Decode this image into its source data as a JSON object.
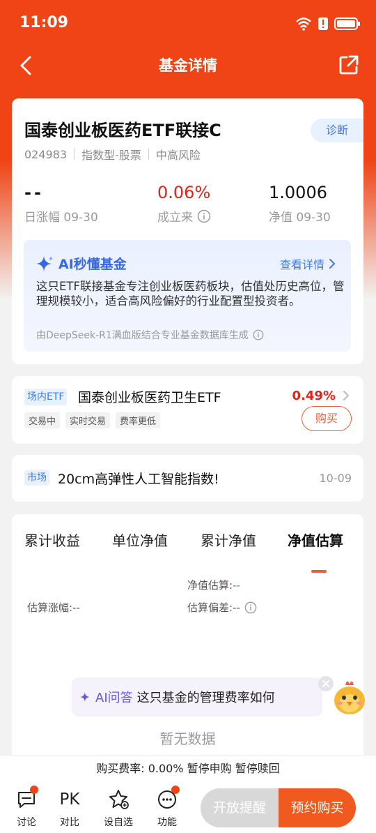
{
  "status": {
    "time": "11:09"
  },
  "nav": {
    "title": "基金详情"
  },
  "fund": {
    "name": "国泰创业板医药ETF联接C",
    "diagnose_label": "诊断",
    "code": "024983",
    "type": "指数型-股票",
    "risk": "中高风险",
    "metrics": [
      {
        "value": "--",
        "label": "日涨幅 09-30"
      },
      {
        "value": "0.06%",
        "label": "成立来"
      },
      {
        "value": "1.0006",
        "label": "净值 09-30"
      }
    ]
  },
  "ai_summary": {
    "title": "AI秒懂基金",
    "more_label": "查看详情",
    "text": "这只ETF联接基金专注创业板医药板块，估值处历史高位，管理规模较小，适合高风险偏好的行业配置型投资者。",
    "source": "由DeepSeek-R1满血版结合专业基金数据库生成"
  },
  "etf": {
    "badge": "场内ETF",
    "name": "国泰创业板医药卫生ETF",
    "change": "0.49%",
    "tags": [
      "交易中",
      "实时交易",
      "费率更低"
    ],
    "buy_label": "购买"
  },
  "market": {
    "badge": "市场",
    "text": "20cm高弹性人工智能指数!",
    "date": "10-09"
  },
  "chart": {
    "tabs": [
      "累计收益",
      "单位净值",
      "累计净值",
      "净值估算"
    ],
    "active_tab": 3,
    "est_nav_label": "净值估算:",
    "est_nav_value": "--",
    "est_change_label": "估算涨幅:",
    "est_change_value": "--",
    "est_dev_label": "估算偏差:",
    "est_dev_value": "--",
    "ai_ask_label": "AI问答",
    "ai_ask_question": "这只基金的管理费率如何",
    "no_data": "暂无数据"
  },
  "fee_bar": {
    "text": "购买费率: 0.00% 暂停申购 暂停赎回"
  },
  "bottom": {
    "items": [
      {
        "label": "讨论",
        "icon": "chat-icon"
      },
      {
        "label": "对比",
        "icon": "pk-icon"
      },
      {
        "label": "设自选",
        "icon": "star-plus-icon"
      },
      {
        "label": "功能",
        "icon": "more-icon"
      }
    ],
    "pk_text": "PK",
    "remind_label": "开放提醒",
    "reserve_label": "预约购买"
  },
  "colors": {
    "brand": "#f04416",
    "up": "#e2231a",
    "link": "#3b7be8"
  }
}
